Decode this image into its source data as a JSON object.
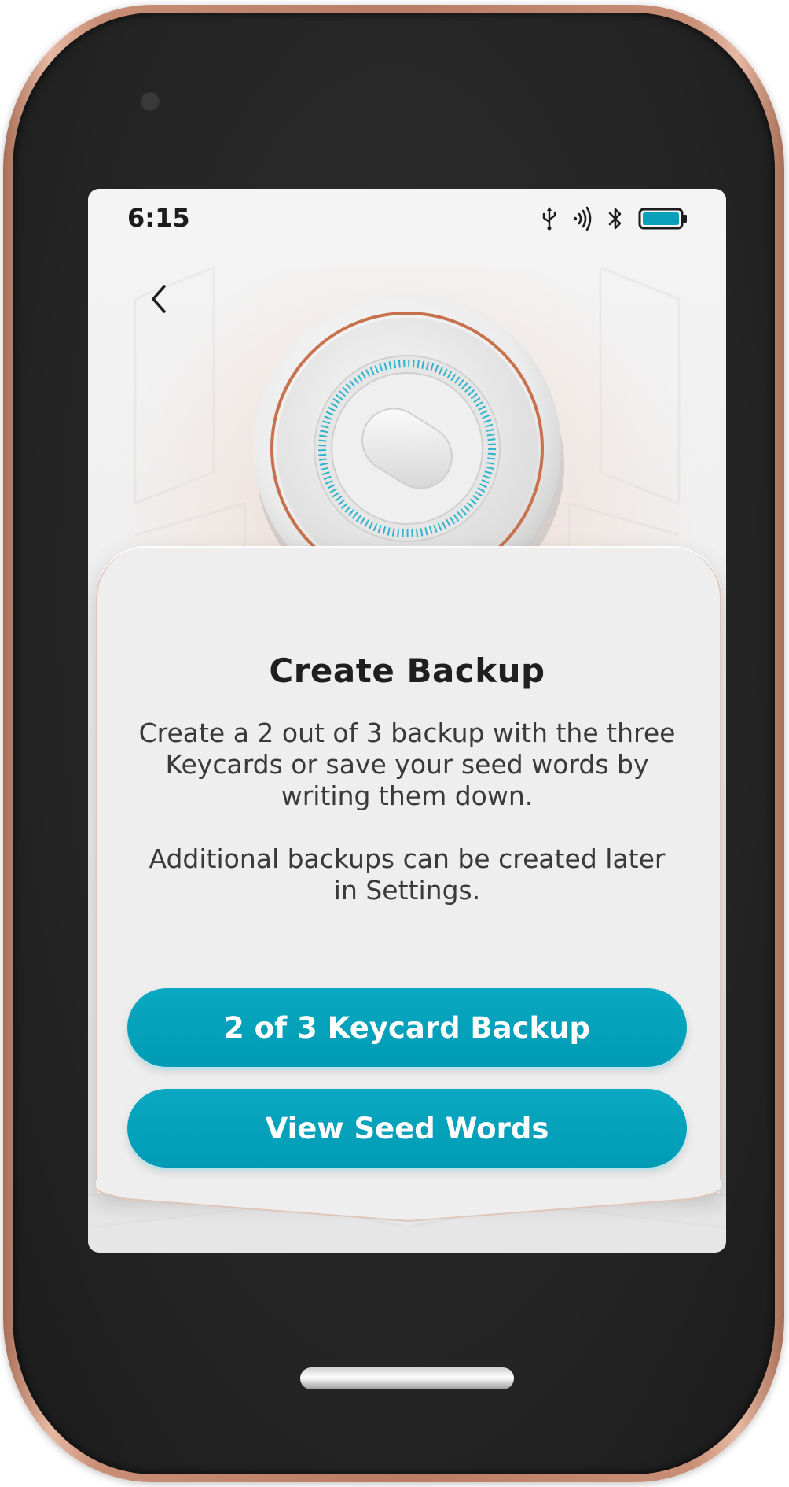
{
  "status_bar": {
    "time": "6:15",
    "icons": [
      "usb-icon",
      "nfc-icon",
      "bluetooth-icon",
      "battery-icon"
    ],
    "battery_color": "#0a9fbb"
  },
  "nav": {
    "back_icon": "chevron-left-icon"
  },
  "hero": {
    "image": "keycard-illustration",
    "ring_accent": "#c8714d",
    "led_color": "#2fb4cc"
  },
  "card": {
    "title": "Create Backup",
    "paragraph_1": "Create a 2 out of 3 backup with the three Keycards or save your seed words by writing them down.",
    "paragraph_2": "Additional backups can be created later in Settings."
  },
  "buttons": {
    "keycard_backup": "2 of 3 Keycard Backup",
    "view_seed_words": "View Seed Words",
    "color": "#019bb5"
  },
  "device": {
    "frame_color": "#c98e76",
    "bezel_color": "#262626"
  }
}
